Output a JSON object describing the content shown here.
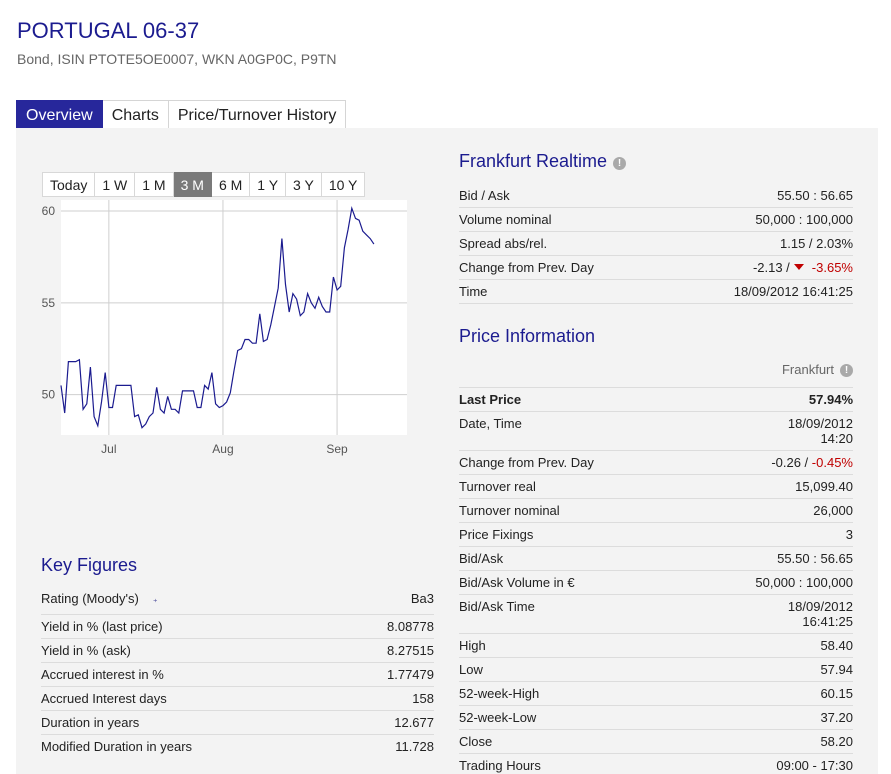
{
  "header": {
    "title": "PORTUGAL 06-37",
    "subtitle": "Bond, ISIN PTOTE5OE0007, WKN A0GP0C, P9TN"
  },
  "tabs": [
    {
      "label": "Overview",
      "active": true
    },
    {
      "label": "Charts",
      "active": false
    },
    {
      "label": "Price/Turnover History",
      "active": false
    }
  ],
  "range_tabs": [
    {
      "label": "Today",
      "active": false
    },
    {
      "label": "1 W",
      "active": false
    },
    {
      "label": "1 M",
      "active": false
    },
    {
      "label": "3 M",
      "active": true
    },
    {
      "label": "6 M",
      "active": false
    },
    {
      "label": "1 Y",
      "active": false
    },
    {
      "label": "3 Y",
      "active": false
    },
    {
      "label": "10 Y",
      "active": false
    }
  ],
  "chart_data": {
    "type": "line",
    "title": "",
    "xlabel": "",
    "ylabel": "",
    "x_ticks": [
      {
        "label": "Jul",
        "day": 13
      },
      {
        "label": "Aug",
        "day": 44
      },
      {
        "label": "Sep",
        "day": 75
      }
    ],
    "y_ticks": [
      50,
      55,
      60
    ],
    "ylim": [
      47.8,
      60.6
    ],
    "xlim": [
      0,
      94
    ],
    "grid": true,
    "color": "#1b1b8f",
    "series": [
      {
        "values": [
          [
            0,
            50.5
          ],
          [
            1,
            49.0
          ],
          [
            2,
            51.8
          ],
          [
            4,
            51.8
          ],
          [
            5,
            51.9
          ],
          [
            6,
            49.2
          ],
          [
            7,
            49.5
          ],
          [
            8,
            51.5
          ],
          [
            9,
            48.8
          ],
          [
            10,
            48.3
          ],
          [
            11,
            49.6
          ],
          [
            12,
            51.2
          ],
          [
            13,
            49.3
          ],
          [
            14,
            49.3
          ],
          [
            15,
            50.5
          ],
          [
            19,
            50.5
          ],
          [
            20,
            48.8
          ],
          [
            21,
            48.9
          ],
          [
            22,
            48.2
          ],
          [
            23,
            48.4
          ],
          [
            24,
            48.8
          ],
          [
            25,
            49.0
          ],
          [
            26,
            50.4
          ],
          [
            27,
            49.2
          ],
          [
            28,
            49.0
          ],
          [
            29,
            49.9
          ],
          [
            30,
            49.2
          ],
          [
            31,
            49.2
          ],
          [
            32,
            49.0
          ],
          [
            33,
            50.2
          ],
          [
            36,
            50.2
          ],
          [
            37,
            49.3
          ],
          [
            38,
            49.3
          ],
          [
            39,
            50.5
          ],
          [
            40,
            50.3
          ],
          [
            41,
            51.2
          ],
          [
            42,
            49.5
          ],
          [
            43,
            49.3
          ],
          [
            44,
            49.4
          ],
          [
            45,
            49.6
          ],
          [
            46,
            50.1
          ],
          [
            47,
            51.3
          ],
          [
            48,
            52.4
          ],
          [
            49,
            52.5
          ],
          [
            50,
            53.0
          ],
          [
            51,
            53.0
          ],
          [
            52,
            52.8
          ],
          [
            53,
            52.8
          ],
          [
            54,
            54.4
          ],
          [
            55,
            52.9
          ],
          [
            56,
            53.0
          ],
          [
            57,
            53.8
          ],
          [
            58,
            54.8
          ],
          [
            59,
            55.8
          ],
          [
            60,
            58.5
          ],
          [
            61,
            56.0
          ],
          [
            62,
            54.5
          ],
          [
            63,
            55.5
          ],
          [
            64,
            55.2
          ],
          [
            65,
            54.3
          ],
          [
            66,
            54.5
          ],
          [
            67,
            55.5
          ],
          [
            68,
            55.0
          ],
          [
            69,
            54.7
          ],
          [
            70,
            55.3
          ],
          [
            71,
            54.8
          ],
          [
            72,
            54.5
          ],
          [
            73,
            54.5
          ],
          [
            74,
            56.4
          ],
          [
            75,
            55.7
          ],
          [
            76,
            55.9
          ],
          [
            77,
            58.0
          ],
          [
            78,
            59.0
          ],
          [
            79,
            60.15
          ],
          [
            80,
            59.6
          ],
          [
            81,
            59.5
          ],
          [
            82,
            58.9
          ],
          [
            83,
            58.7
          ],
          [
            84,
            58.5
          ],
          [
            85,
            58.2
          ]
        ]
      }
    ]
  },
  "frankfurt_realtime": {
    "title": "Frankfurt Realtime",
    "rows": [
      {
        "label": "Bid / Ask",
        "value": "55.50 : 56.65"
      },
      {
        "label": "Volume nominal",
        "value": "50,000 : 100,000"
      },
      {
        "label": "Spread abs/rel.",
        "value": "1.15 / 2.03%"
      },
      {
        "label": "Change from Prev. Day",
        "value_abs": "-2.13 /",
        "value_rel": "-3.65%"
      },
      {
        "label": "Time",
        "value": "18/09/2012 16:41:25"
      }
    ]
  },
  "price_information": {
    "title": "Price Information",
    "venue": "Frankfurt",
    "rows": [
      {
        "label": "Last Price",
        "value": "57.94%",
        "bold": true
      },
      {
        "label": "Date, Time",
        "value": "18/09/2012",
        "value2": "14:20"
      },
      {
        "label": "Change from Prev. Day",
        "value_abs": "-0.26 /",
        "value_rel": "-0.45%"
      },
      {
        "label": "Turnover real",
        "value": "15,099.40"
      },
      {
        "label": "Turnover nominal",
        "value": "26,000"
      },
      {
        "label": "Price Fixings",
        "value": "3"
      },
      {
        "label": "Bid/Ask",
        "value": "55.50 : 56.65"
      },
      {
        "label": "Bid/Ask Volume in €",
        "value": "50,000 : 100,000"
      },
      {
        "label": "Bid/Ask Time",
        "value": "18/09/2012",
        "value2": "16:41:25"
      },
      {
        "label": "High",
        "value": "58.40"
      },
      {
        "label": "Low",
        "value": "57.94"
      },
      {
        "label": "52-week-High",
        "value": "60.15"
      },
      {
        "label": "52-week-Low",
        "value": "37.20"
      },
      {
        "label": "Close",
        "value": "58.20"
      },
      {
        "label": "Trading Hours",
        "value": "09:00 - 17:30"
      }
    ]
  },
  "key_figures": {
    "title": "Key Figures",
    "rows": [
      {
        "label": "Rating (Moody's)",
        "value": "Ba3"
      },
      {
        "label": "Yield in % (last price)",
        "value": "8.08778"
      },
      {
        "label": "Yield in % (ask)",
        "value": "8.27515"
      },
      {
        "label": "Accrued interest in %",
        "value": "1.77479"
      },
      {
        "label": "Accrued Interest days",
        "value": "158"
      },
      {
        "label": "Duration in years",
        "value": "12.677"
      },
      {
        "label": "Modified Duration in years",
        "value": "11.728"
      }
    ]
  }
}
